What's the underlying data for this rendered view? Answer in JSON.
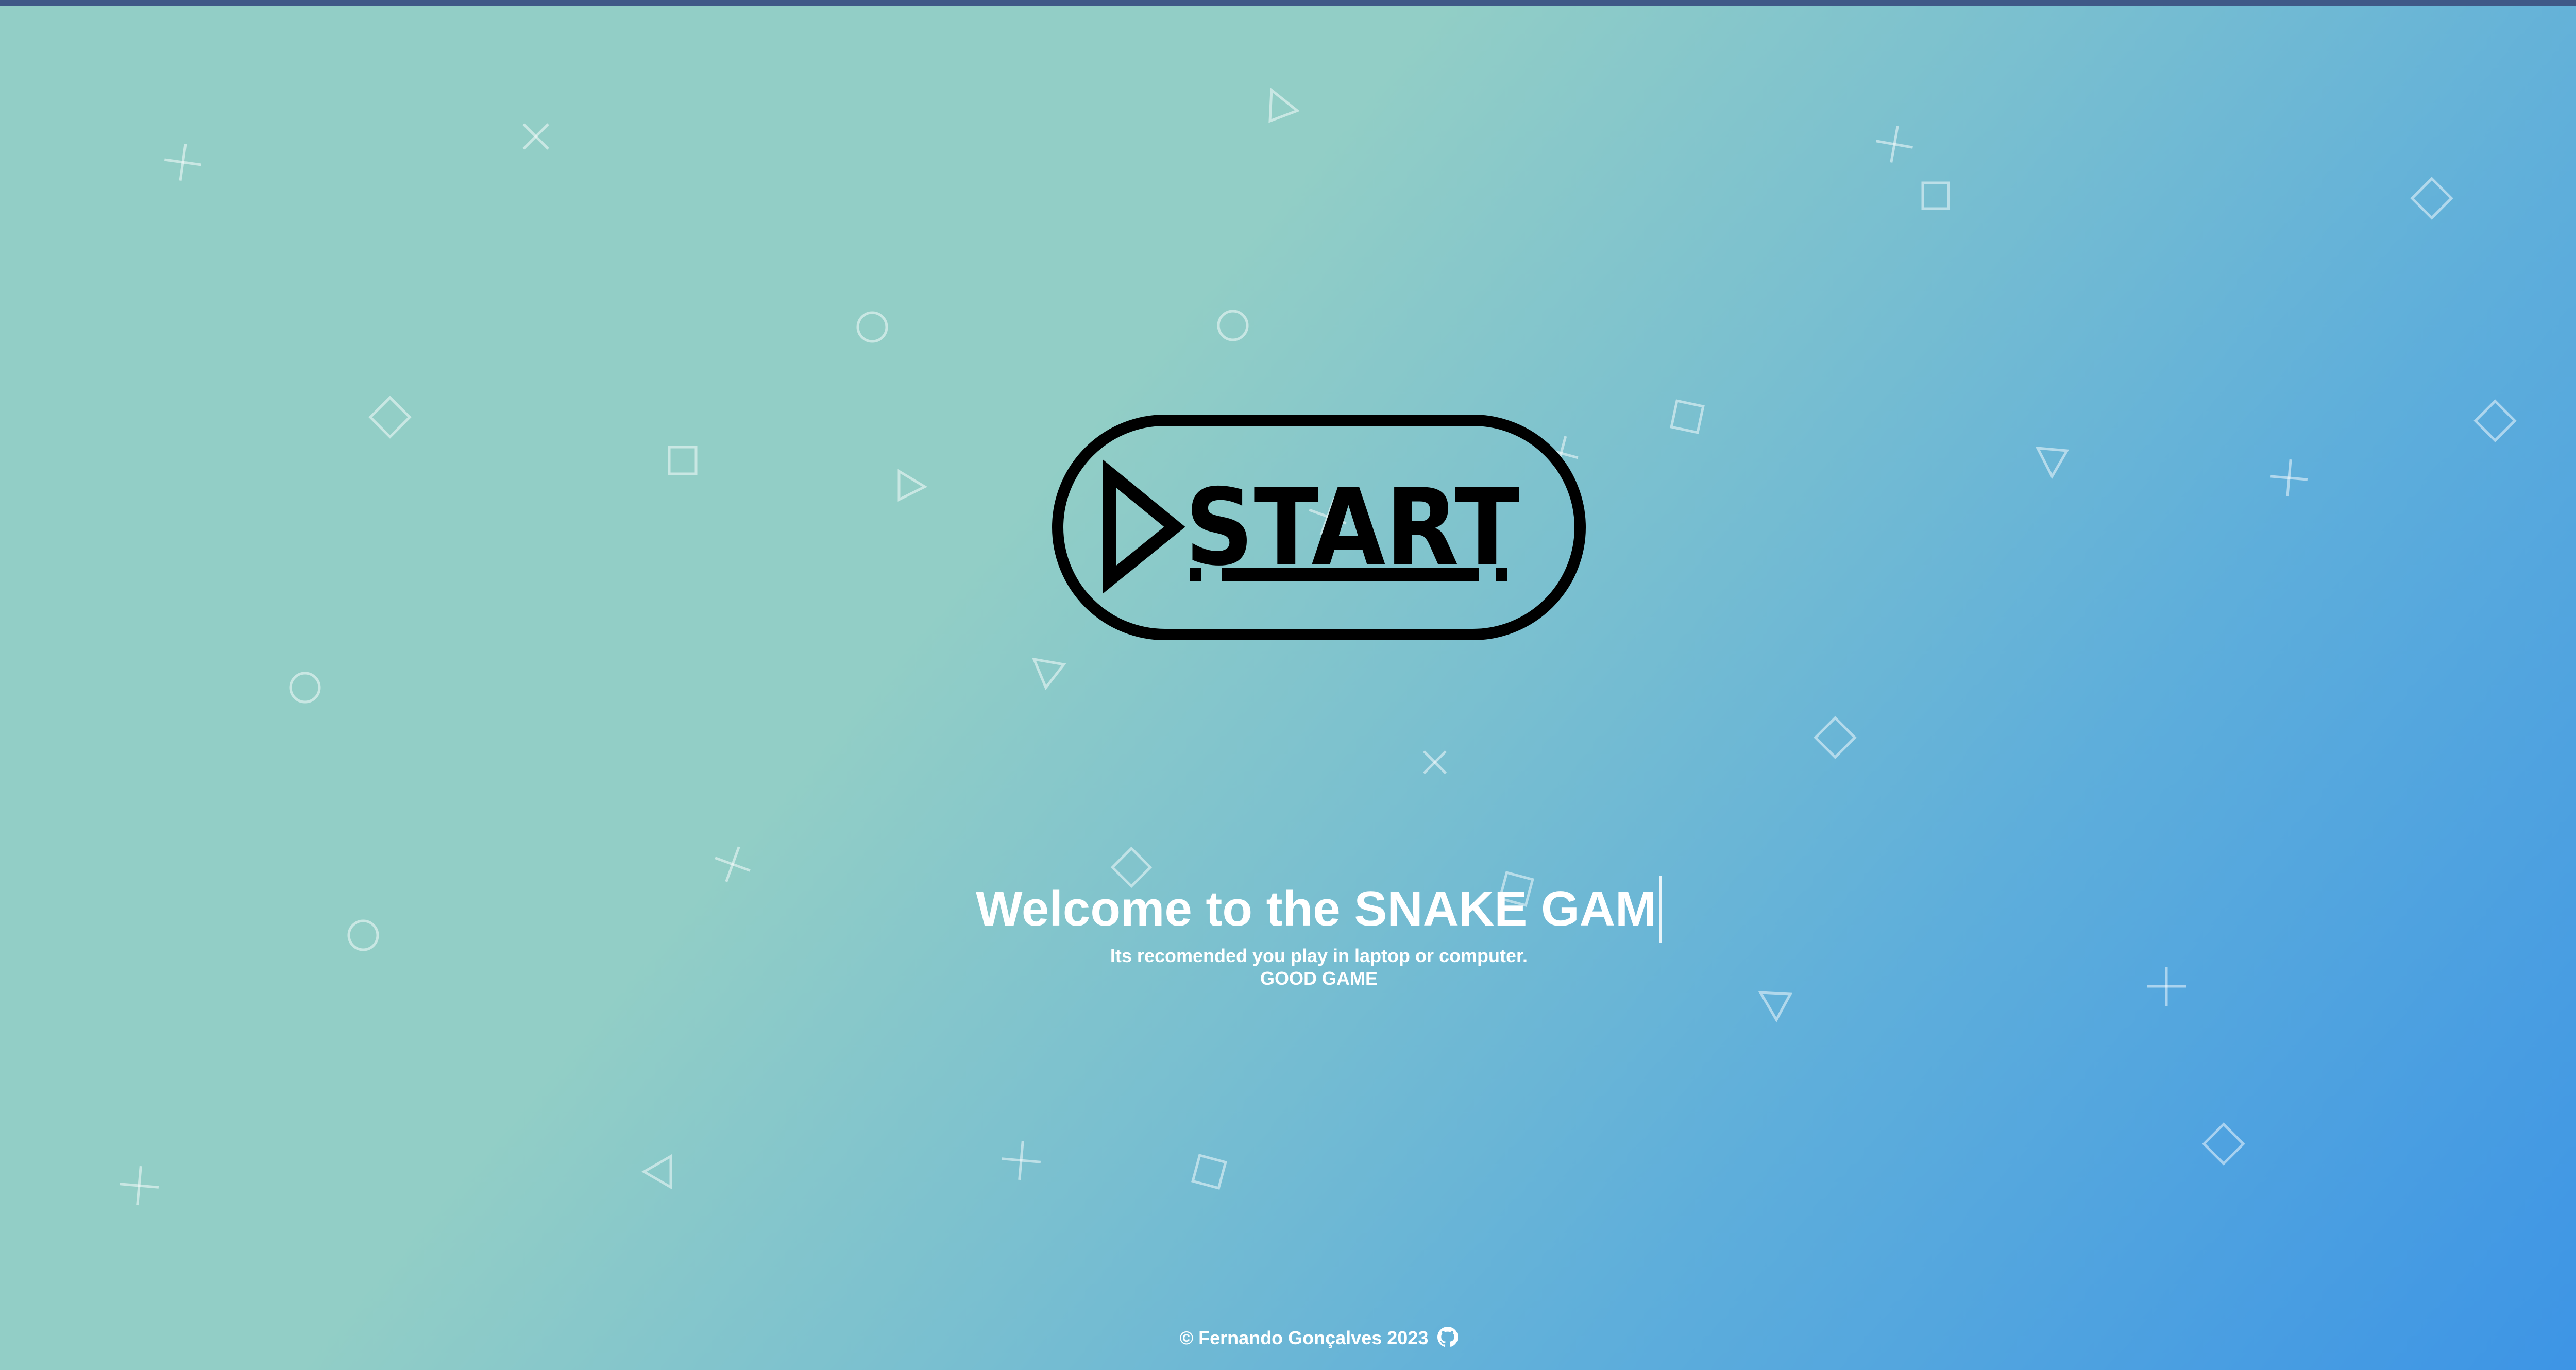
{
  "welcome": {
    "title": "Welcome to the SNAKE GAM",
    "subtitle": "Its recomended you play in laptop or computer.",
    "tagline": "GOOD GAME"
  },
  "start_button": {
    "label": "START",
    "icon": "play-triangle-icon"
  },
  "footer": {
    "credit": "© Fernando Gonçalves 2023",
    "icon": "github-icon"
  },
  "colors": {
    "top_bar": "#3f5987",
    "background_start": "#92cec6",
    "background_end": "#3b93e6",
    "text": "#ffffff",
    "button": "#000000"
  }
}
